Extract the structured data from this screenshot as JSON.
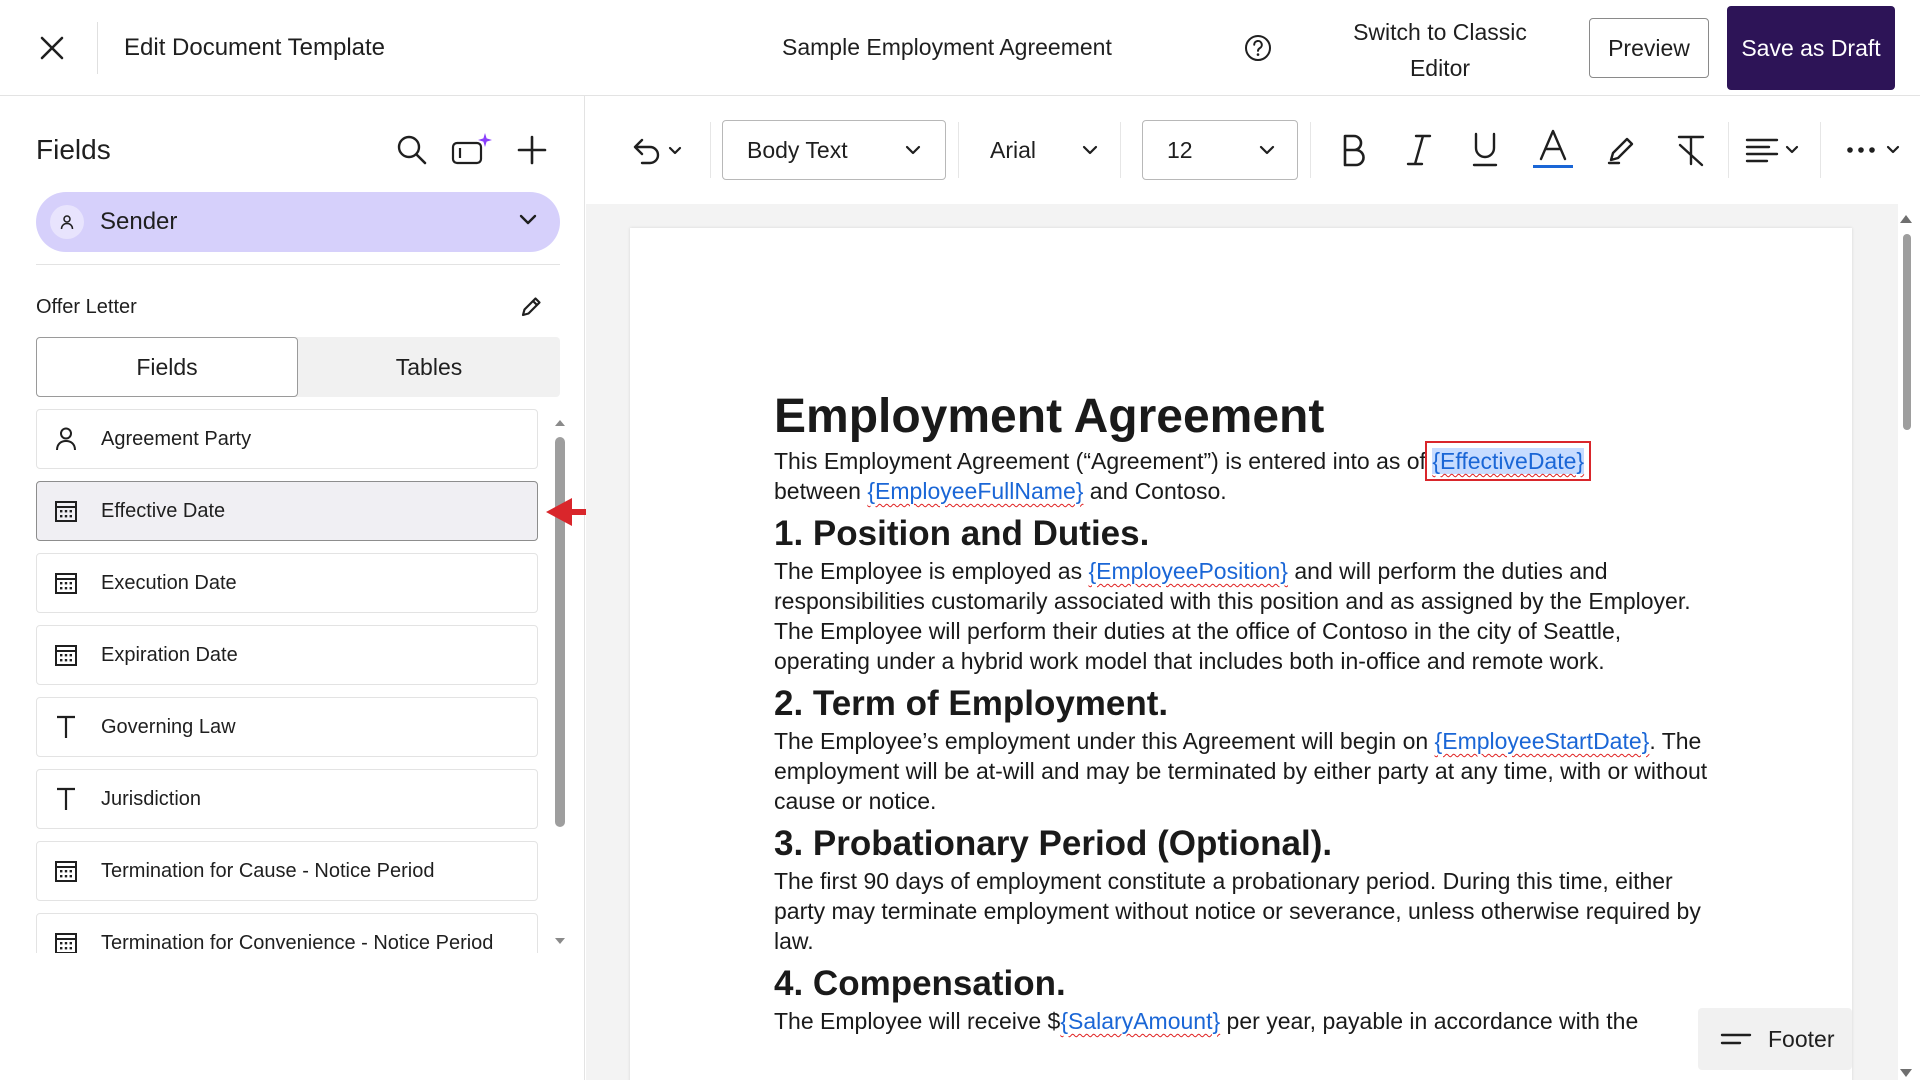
{
  "topbar": {
    "title": "Edit Document Template",
    "document_name": "Sample Employment Agreement",
    "switch_classic": "Switch to Classic Editor",
    "preview_label": "Preview",
    "save_draft_label": "Save as Draft"
  },
  "sidebar": {
    "header": "Fields",
    "sender_label": "Sender",
    "section_label": "Offer Letter",
    "tabs": [
      {
        "label": "Fields",
        "active": true
      },
      {
        "label": "Tables",
        "active": false
      }
    ],
    "fields": [
      {
        "label": "Agreement Party",
        "icon": "person-icon"
      },
      {
        "label": "Effective Date",
        "icon": "calendar-icon",
        "selected": true
      },
      {
        "label": "Execution Date",
        "icon": "calendar-icon"
      },
      {
        "label": "Expiration Date",
        "icon": "calendar-icon"
      },
      {
        "label": "Governing Law",
        "icon": "text-icon"
      },
      {
        "label": "Jurisdiction",
        "icon": "text-icon"
      },
      {
        "label": "Termination for Cause - Notice Period",
        "icon": "calendar-icon"
      },
      {
        "label": "Termination for Convenience - Notice Period",
        "icon": "calendar-icon"
      }
    ]
  },
  "toolbar": {
    "style_value": "Body Text",
    "font_value": "Arial",
    "size_value": "12"
  },
  "document": {
    "title": "Employment Agreement",
    "intro_1": "This Employment Agreement (“Agreement”) is entered into as of ",
    "ph_effective_date": "{EffectiveDate}",
    "intro_2": "between ",
    "ph_employee_full_name": "{EmployeeFullName}",
    "intro_3": " and Contoso.",
    "s1_heading": "1. Position and Duties.",
    "s1_text_1": "The Employee is employed as ",
    "ph_employee_position": "{EmployeePosition}",
    "s1_text_2": " and will perform the duties and responsibilities customarily associated with this position and as assigned by the Employer. The Employee will perform their duties at the office of Contoso in the city of Seattle, operating under a hybrid work model that includes both in-office and remote work.",
    "s2_heading": "2. Term of Employment.",
    "s2_text_1": "The Employee’s employment under this Agreement will begin on ",
    "ph_employee_start_date": "{EmployeeStartDate}",
    "s2_text_2": ". The employment will be at-will and may be terminated by either party at any time, with or without cause or notice.",
    "s3_heading": "3. Probationary Period (Optional).",
    "s3_text": "The first 90 days of employment constitute a probationary period. During this time, either party may terminate employment without notice or severance, unless otherwise required by law.",
    "s4_heading": "4. Compensation.",
    "s4_text_1": "The Employee will receive $",
    "ph_salary_amount": "{SalaryAmount}",
    "s4_text_2": " per year, payable in accordance with the"
  },
  "footer_button": "Footer",
  "colors": {
    "primary_dark": "#2d1457",
    "sender_pill": "#d6d0fb",
    "placeholder_blue": "#1a66d6",
    "highlight_red": "#d9262b"
  }
}
